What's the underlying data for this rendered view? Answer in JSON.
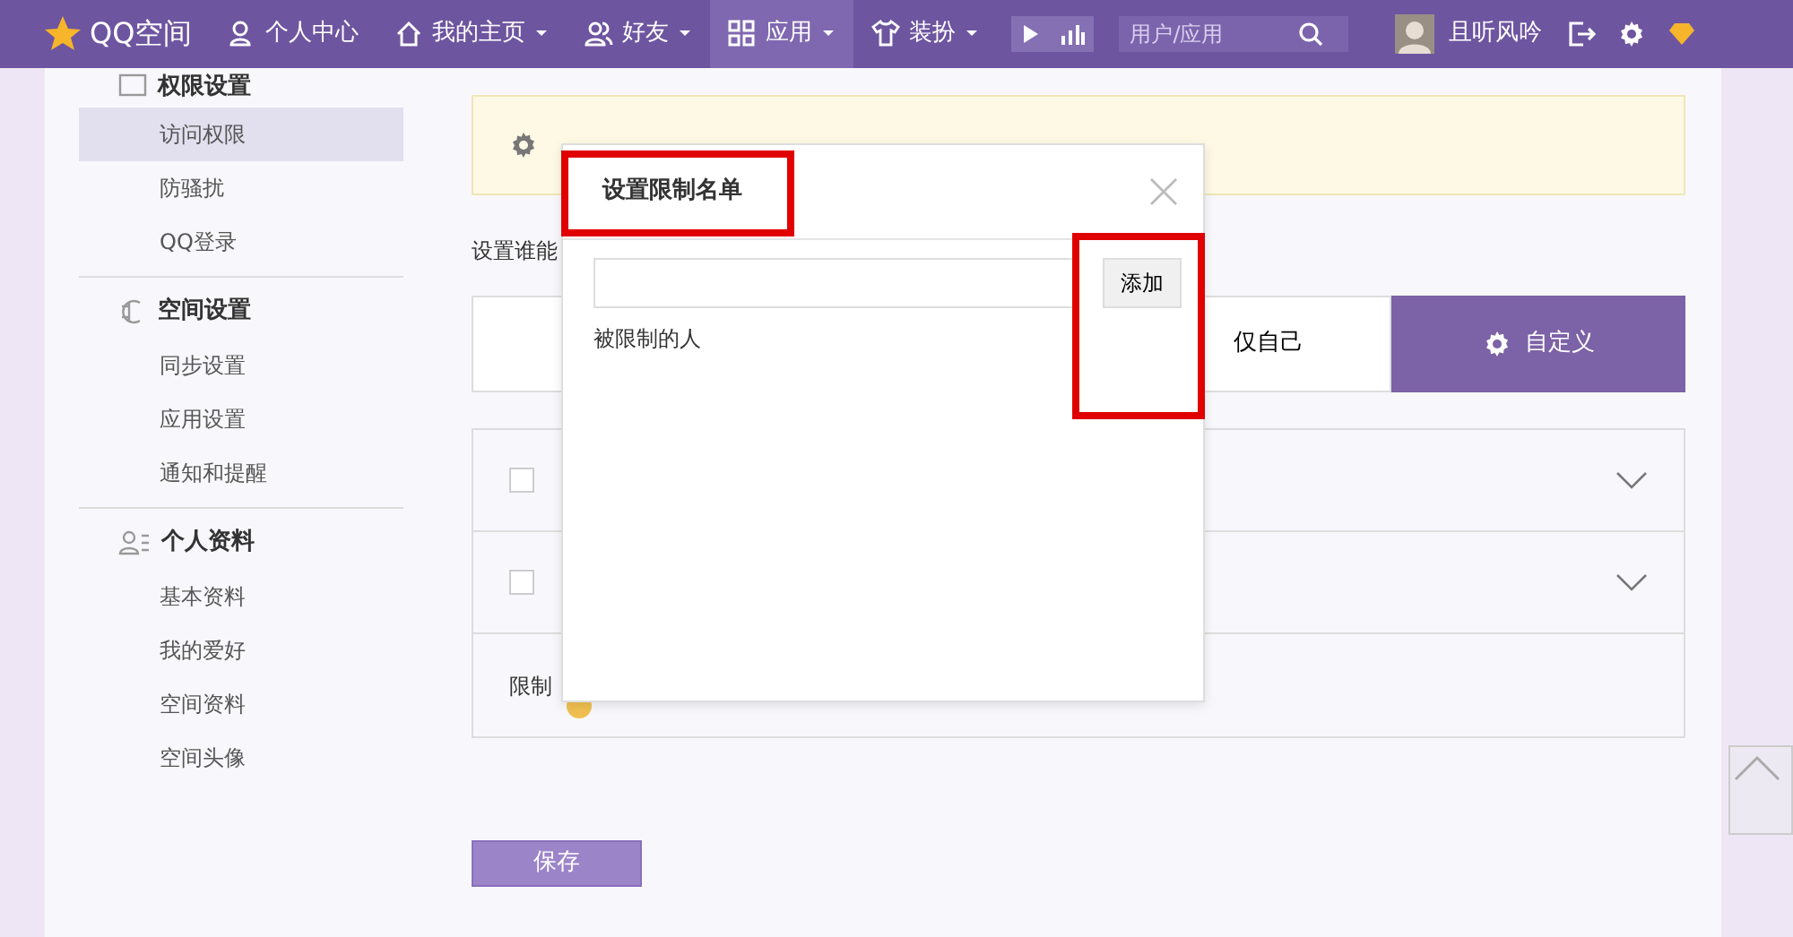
{
  "navbar": {
    "logo": "QQ空间",
    "items": [
      {
        "label": "个人中心",
        "dropdown": false,
        "selected": false
      },
      {
        "label": "我的主页",
        "dropdown": true,
        "selected": false
      },
      {
        "label": "好友",
        "dropdown": true,
        "selected": false
      },
      {
        "label": "应用",
        "dropdown": true,
        "selected": true
      },
      {
        "label": "装扮",
        "dropdown": true,
        "selected": false
      }
    ],
    "search": {
      "placeholder": "用户/应用"
    },
    "user": "且听风吟"
  },
  "sidebar": {
    "sections": [
      {
        "title": "权限设置",
        "items": [
          {
            "label": "访问权限",
            "selected": true
          },
          {
            "label": "防骚扰",
            "selected": false
          },
          {
            "label": "QQ登录",
            "selected": false
          }
        ]
      },
      {
        "title": "空间设置",
        "items": [
          {
            "label": "同步设置",
            "selected": false
          },
          {
            "label": "应用设置",
            "selected": false
          },
          {
            "label": "通知和提醒",
            "selected": false
          }
        ]
      },
      {
        "title": "个人资料",
        "items": [
          {
            "label": "基本资料",
            "selected": false
          },
          {
            "label": "我的爱好",
            "selected": false
          },
          {
            "label": "空间资料",
            "selected": false
          },
          {
            "label": "空间头像",
            "selected": false
          }
        ]
      }
    ]
  },
  "access": {
    "label": "设置谁能",
    "options": [
      {
        "label": "仅自己",
        "selected": false
      },
      {
        "label": "自定义",
        "selected": true
      }
    ],
    "rows": [
      {
        "checked": false
      },
      {
        "checked": false
      }
    ],
    "limit_label": "限制"
  },
  "save": "保存",
  "dialog": {
    "title": "设置限制名单",
    "add": "添加",
    "list_label": "被限制的人"
  }
}
